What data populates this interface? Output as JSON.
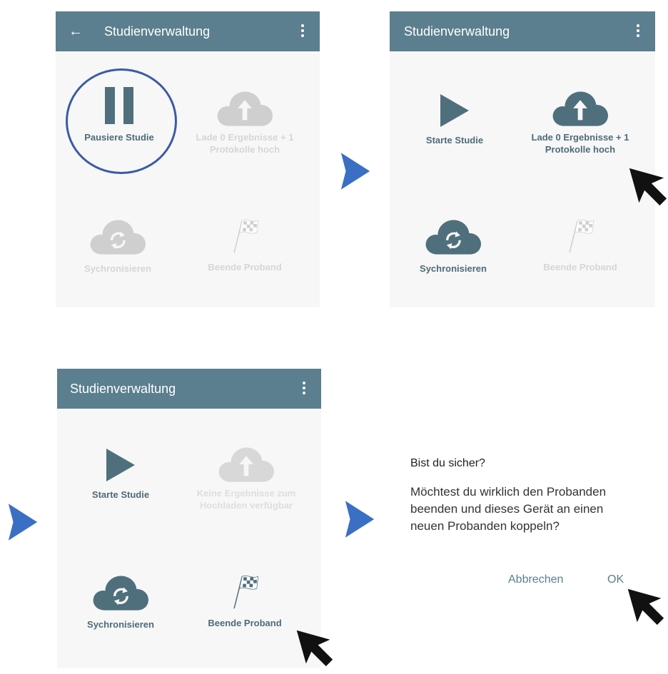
{
  "panel1": {
    "title": "Studienverwaltung",
    "back_icon": "←",
    "pause_label": "Pausiere Studie",
    "upload_label": "Lade 0 Ergebnisse + 1 Protokolle hoch",
    "sync_label": "Sychronisieren",
    "finish_label": "Beende Proband"
  },
  "panel2": {
    "title": "Studienverwaltung",
    "start_label": "Starte Studie",
    "upload_label": "Lade 0 Ergebnisse + 1 Protokolle hoch",
    "sync_label": "Sychronisieren",
    "finish_label": "Beende Proband"
  },
  "panel3": {
    "title": "Studienverwaltung",
    "start_label": "Starte Studie",
    "upload_label": "Keine Ergebnisse zum Hochladen verfügbar",
    "sync_label": "Sychronisieren",
    "finish_label": "Beende Proband"
  },
  "dialog": {
    "title": "Bist du sicher?",
    "message": "Möchtest du wirklich den Probanden beenden und dieses Gerät an einen neuen Probanden koppeln?",
    "cancel_label": "Abbrechen",
    "ok_label": "OK"
  },
  "colors": {
    "appbar": "#5b7f8e",
    "active_icon": "#4f6f7c",
    "disabled_icon": "#cfcfcf",
    "highlight_ring": "#3b5ba5",
    "arrow": "#3a6fc4"
  },
  "icons": {
    "pause": "pause-icon",
    "play": "play-icon",
    "upload": "cloud-upload-icon",
    "sync": "cloud-sync-icon",
    "finish": "checkered-flag-icon",
    "next": "chevron-right-icon",
    "pointer": "mouse-cursor-icon",
    "menu": "more-vert-icon",
    "back": "arrow-back-icon"
  }
}
